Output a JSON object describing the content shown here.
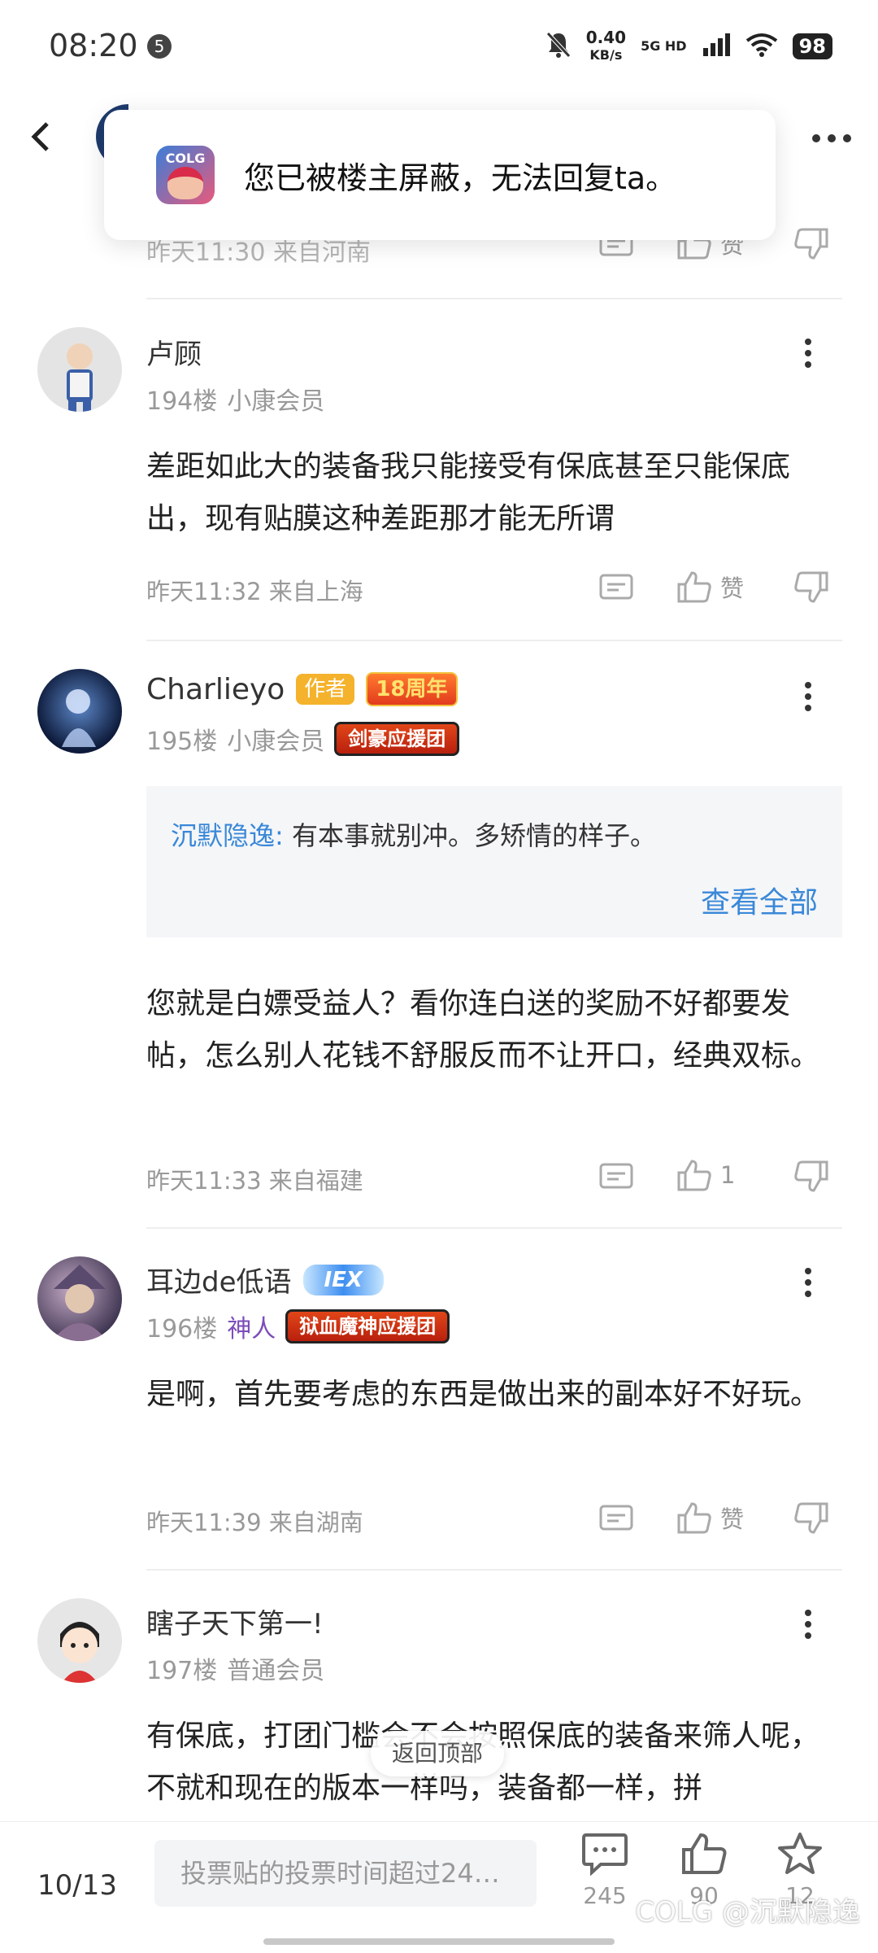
{
  "status_bar": {
    "time": "08:20",
    "notif_badge": "5",
    "net_speed": "0.40",
    "net_unit": "KB/s",
    "network": "5G HD",
    "battery": "98"
  },
  "toast": {
    "text": "您已被楼主屏蔽，无法回复ta。",
    "app_logo_text": "COLG"
  },
  "prev_comment": {
    "meta": "昨天11:30 来自河南",
    "like_label": "赞"
  },
  "comments": [
    {
      "username": "卢顾",
      "floor": "194楼",
      "rank": "小康会员",
      "body": "差距如此大的装备我只能接受有保底甚至只能保底出，现有贴膜这种差距那才能无所谓",
      "meta": "昨天11:32 来自上海",
      "likes": "赞"
    },
    {
      "username": "Charlieyo",
      "author_tag": "作者",
      "anniv_tag": "18周年",
      "floor": "195楼",
      "rank": "小康会员",
      "club_tag": "剑豪应援团",
      "quote_name": "沉默隐逸:",
      "quote_text": "有本事就别冲。多矫情的样子。",
      "quote_more": "查看全部",
      "body": "您就是白嫖受益人？看你连白送的奖励不好都要发帖，怎么别人花钱不舒服反而不让开口，经典双标。",
      "meta": "昨天11:33 来自福建",
      "likes": "1"
    },
    {
      "username": "耳边de低语",
      "level_tag": "IEX",
      "floor": "196楼",
      "rank": "神人",
      "club_tag": "狱血魔神应援团",
      "body": "是啊，首先要考虑的东西是做出来的副本好不好玩。",
      "meta": "昨天11:39 来自湖南",
      "likes": "赞"
    },
    {
      "username": "瞎子天下第一!",
      "floor": "197楼",
      "rank": "普通会员",
      "body": "有保底，打团门槛会不会按照保底的装备来筛人呢，不就和现在的版本一样吗，装备都一样，拼"
    }
  ],
  "back_to_top": "返回顶部",
  "bottom_bar": {
    "page": "10/13",
    "input_placeholder": "投票贴的投票时间超过24…",
    "comments_count": "245",
    "likes_count": "90",
    "favorites_count": "12"
  },
  "watermark": "COLG @沉默隐逸"
}
